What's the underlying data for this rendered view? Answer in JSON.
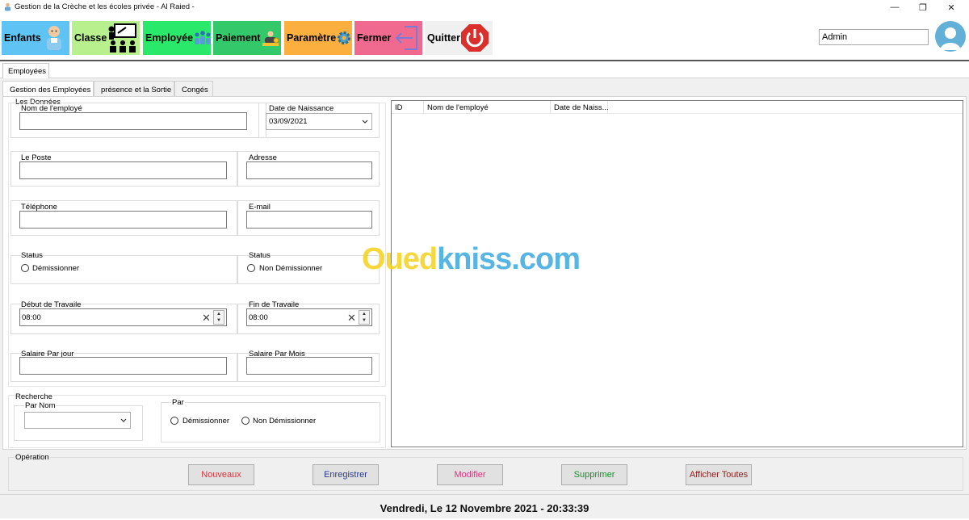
{
  "window": {
    "title": "Gestion de la Crèche et les écoles privée - Al Raied -",
    "minimize_glyph": "—",
    "restore_glyph": "❐",
    "close_glyph": "✕"
  },
  "menu": {
    "enfants": "Enfants",
    "classe": "Classe",
    "employee": "Employée",
    "paiement": "Paiement",
    "parametre": "Paramètre",
    "fermer": "Fermer",
    "quitter": "Quitter",
    "colors": {
      "enfants": "#5fc4f4",
      "classe": "#b8f08e",
      "employee": "#2ae86a",
      "paiement": "#33c96a",
      "parametre": "#fbaf3e",
      "fermer": "#f06a8f",
      "quitter": "#f0f0f0"
    }
  },
  "user": {
    "name": "Admin"
  },
  "tabs": {
    "outer": "Employées",
    "inner": [
      "Gestion des Employées",
      "présence et la Sortie",
      "Congés"
    ]
  },
  "form": {
    "group_title": "Les Données",
    "nom_label": "Nom de l'employé",
    "date_label": "Date de Naissance",
    "date_value": "03/09/2021",
    "poste_label": "Le Poste",
    "adresse_label": "Adresse",
    "telephone_label": "Téléphone",
    "email_label": "E-mail",
    "status_label_1": "Status",
    "status_option_1": "Démissionner",
    "status_label_2": "Status",
    "status_option_2": "Non Démissionner",
    "debut_label": "Début de Travaile",
    "debut_value": "08:00",
    "fin_label": "Fin de Travaile",
    "fin_value": "08:00",
    "salaire_jour_label": "Salaire Par jour",
    "salaire_mois_label": "Salaire Par Mois"
  },
  "search": {
    "group_title": "Recherche",
    "par_nom_label": "Par Nom",
    "par_label": "Par",
    "option_1": "Démissionner",
    "option_2": "Non Démissionner"
  },
  "table": {
    "columns": [
      "ID",
      "Nom de l'employé",
      "Date de Naiss..."
    ]
  },
  "operations": {
    "title": "Opération",
    "buttons": [
      {
        "label": "Nouveaux",
        "color": "#d9363e"
      },
      {
        "label": "Enregistrer",
        "color": "#2b3a8c"
      },
      {
        "label": "Modifier",
        "color": "#d4357a"
      },
      {
        "label": "Supprimer",
        "color": "#1f8a2e"
      },
      {
        "label": "Afficher Toutes",
        "color": "#8a1f1f"
      }
    ]
  },
  "status_bar": {
    "datetime": "Vendredi, Le 12 Novembre 2021 - 20:33:39"
  },
  "watermark": {
    "part1": "Oued",
    "part2": "kniss",
    "part3": ".com",
    "color1": "#f5d21b",
    "color2": "#3aa9e0"
  }
}
